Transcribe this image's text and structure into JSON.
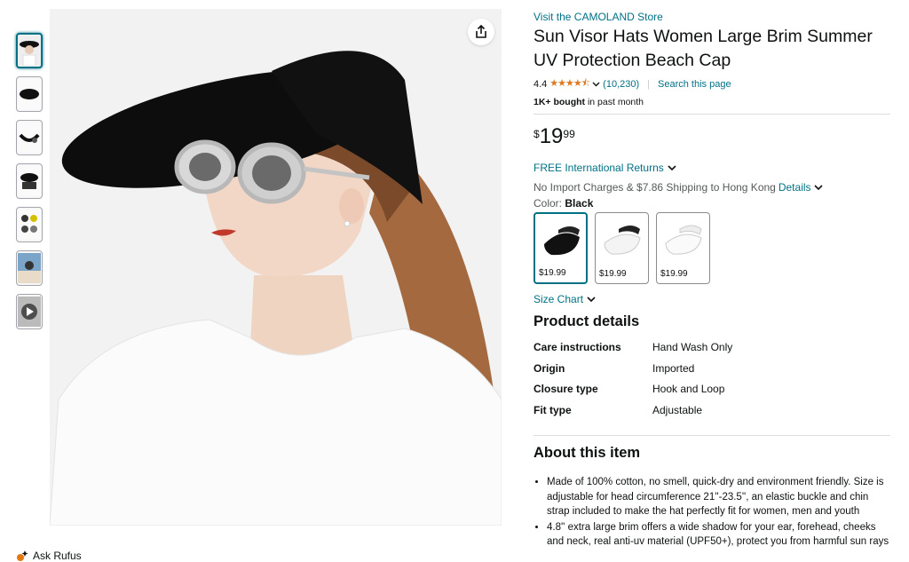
{
  "store_link": "Visit the CAMOLAND Store",
  "product_title": "Sun Visor Hats Women Large Brim Summer UV Protection Beach Cap",
  "rating": {
    "value": "4.4",
    "stars": "★★★★⯪",
    "count": "(10,230)",
    "search_link": "Search this page"
  },
  "bought": {
    "bold": "1K+ bought",
    "rest": " in past month"
  },
  "price": {
    "symbol": "$",
    "whole": "19",
    "fraction": "99"
  },
  "returns_label": "FREE International Returns",
  "shipping": {
    "text": "No Import Charges & $7.86 Shipping to Hong Kong",
    "details_link": "Details"
  },
  "color": {
    "label": "Color:",
    "selected": "Black"
  },
  "swatches": [
    {
      "price": "$19.99",
      "color": "#111111"
    },
    {
      "price": "$19.99",
      "color": "#f2f2f2"
    },
    {
      "price": "$19.99",
      "color": "#ffffff"
    }
  ],
  "size_chart": "Size Chart",
  "product_details": {
    "heading": "Product details",
    "rows": [
      {
        "key": "Care instructions",
        "value": "Hand Wash Only"
      },
      {
        "key": "Origin",
        "value": "Imported"
      },
      {
        "key": "Closure type",
        "value": "Hook and Loop"
      },
      {
        "key": "Fit type",
        "value": "Adjustable"
      }
    ]
  },
  "about": {
    "heading": "About this item",
    "bullets": [
      "Made of 100% cotton, no smell, quick-dry and environment friendly. Size is adjustable for head circumference 21''-23.5'', an elastic buckle and chin strap included to make the hat perfectly fit for women, men and youth",
      "4.8'' extra large brim offers a wide shadow for your ear, forehead, cheeks and neck, real anti-uv material (UPF50+), protect you from harmful sun rays"
    ]
  },
  "ask_rufus": "Ask Rufus",
  "colors": {
    "link": "#007185",
    "star": "#de7921",
    "brand_accent": "#007185"
  },
  "icons": [
    "share-icon",
    "chevron-down-icon",
    "rufus-icon",
    "play-icon"
  ]
}
